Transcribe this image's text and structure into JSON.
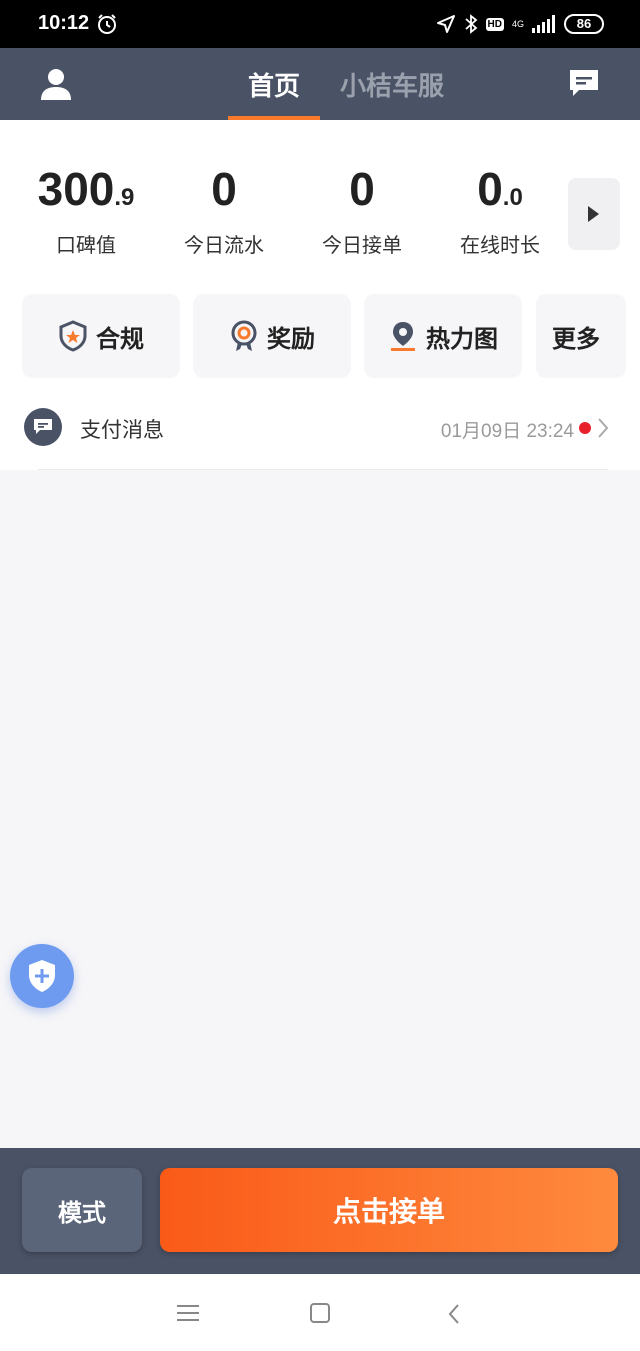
{
  "status_bar": {
    "time": "10:12",
    "network": "4G",
    "hd": "HD",
    "battery": "86"
  },
  "header": {
    "tabs": [
      {
        "label": "首页",
        "active": true
      },
      {
        "label": "小桔车服",
        "active": false
      }
    ]
  },
  "stats": [
    {
      "value": "300",
      "decimal": ".9",
      "label": "口碑值"
    },
    {
      "value": "0",
      "decimal": "",
      "label": "今日流水"
    },
    {
      "value": "0",
      "decimal": "",
      "label": "今日接单"
    },
    {
      "value": "0",
      "decimal": ".0",
      "label": "在线时长"
    }
  ],
  "actions": [
    {
      "label": "合规",
      "icon": "shield-star-icon"
    },
    {
      "label": "奖励",
      "icon": "medal-icon"
    },
    {
      "label": "热力图",
      "icon": "location-pin-icon"
    },
    {
      "label": "更多",
      "icon": ""
    }
  ],
  "message": {
    "title": "支付消息",
    "time": "01月09日 23:24",
    "unread": true
  },
  "bottom": {
    "mode_label": "模式",
    "accept_label": "点击接单"
  },
  "colors": {
    "header_bg": "#4a5366",
    "accent": "#f97a2c",
    "accept_gradient_start": "#fa5a18",
    "accept_gradient_end": "#fe8a3e",
    "unread_dot": "#e8202a",
    "fab": "#6e9bf0"
  }
}
